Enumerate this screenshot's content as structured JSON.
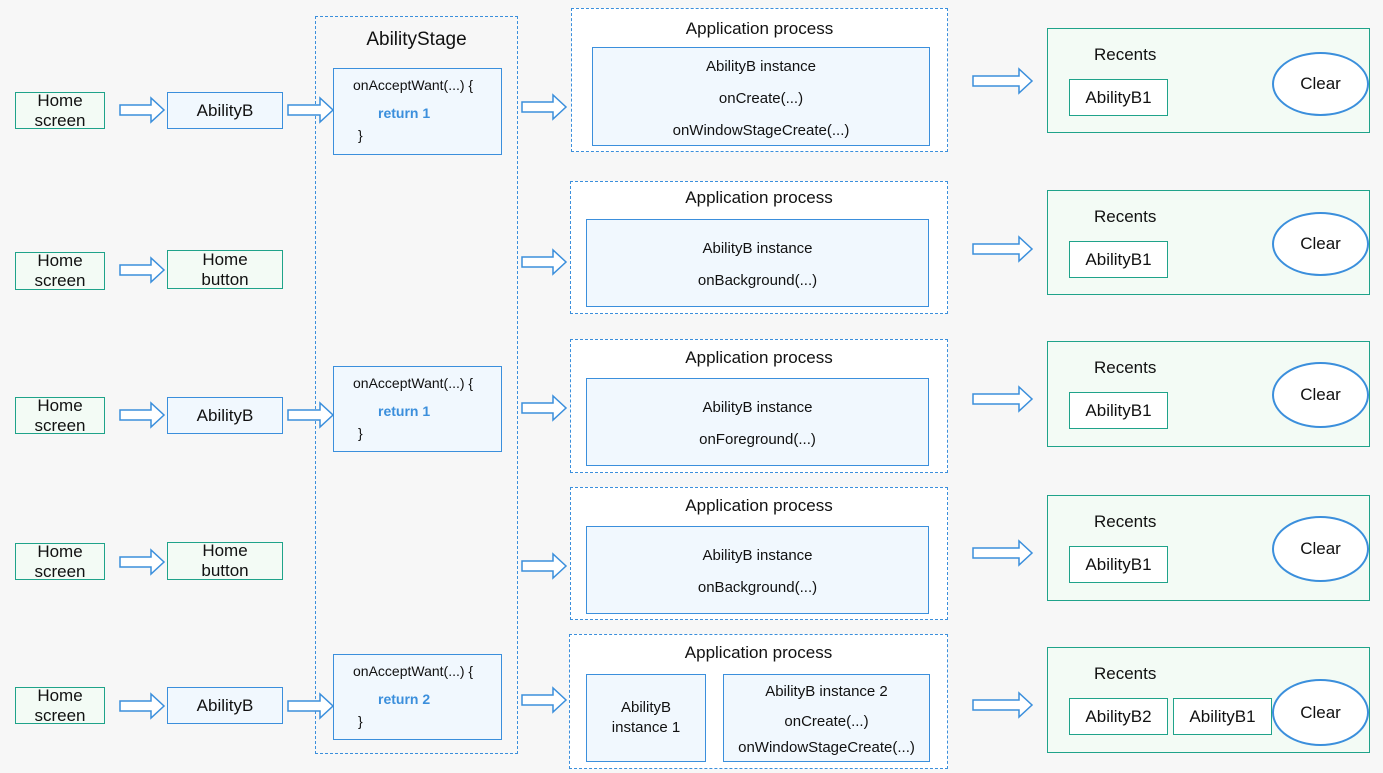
{
  "ability_stage": {
    "title": "AbilityStage"
  },
  "rows": [
    {
      "left": {
        "from": "Home screen",
        "to": "AbilityB"
      },
      "accept": {
        "open": "onAcceptWant(...) {",
        "ret": "return 1",
        "close": "}"
      },
      "process": {
        "title": "Application process",
        "lines": [
          "AbilityB instance",
          "onCreate(...)",
          "onWindowStageCreate(...)"
        ]
      },
      "recents": {
        "title": "Recents",
        "items": [
          "AbilityB1"
        ],
        "clear": "Clear"
      }
    },
    {
      "left": {
        "from": "Home screen",
        "to": "Home button"
      },
      "process": {
        "title": "Application process",
        "lines": [
          "AbilityB instance",
          "onBackground(...)"
        ]
      },
      "recents": {
        "title": "Recents",
        "items": [
          "AbilityB1"
        ],
        "clear": "Clear"
      }
    },
    {
      "left": {
        "from": "Home screen",
        "to": "AbilityB"
      },
      "accept": {
        "open": "onAcceptWant(...) {",
        "ret": "return 1",
        "close": "}"
      },
      "process": {
        "title": "Application process",
        "lines": [
          "AbilityB instance",
          "onForeground(...)"
        ]
      },
      "recents": {
        "title": "Recents",
        "items": [
          "AbilityB1"
        ],
        "clear": "Clear"
      }
    },
    {
      "left": {
        "from": "Home screen",
        "to": "Home button"
      },
      "process": {
        "title": "Application process",
        "lines": [
          "AbilityB instance",
          "onBackground(...)"
        ]
      },
      "recents": {
        "title": "Recents",
        "items": [
          "AbilityB1"
        ],
        "clear": "Clear"
      }
    },
    {
      "left": {
        "from": "Home screen",
        "to": "AbilityB"
      },
      "accept": {
        "open": "onAcceptWant(...) {",
        "ret": "return 2",
        "close": "}"
      },
      "process": {
        "title": "Application process",
        "instance1": "AbilityB instance 1",
        "lines": [
          "AbilityB instance 2",
          "onCreate(...)",
          "onWindowStageCreate(...)"
        ]
      },
      "recents": {
        "title": "Recents",
        "items": [
          "AbilityB2",
          "AbilityB1"
        ],
        "clear": "Clear"
      }
    }
  ],
  "colors": {
    "blue": "#3b8fdc",
    "green": "#1fa38a"
  }
}
